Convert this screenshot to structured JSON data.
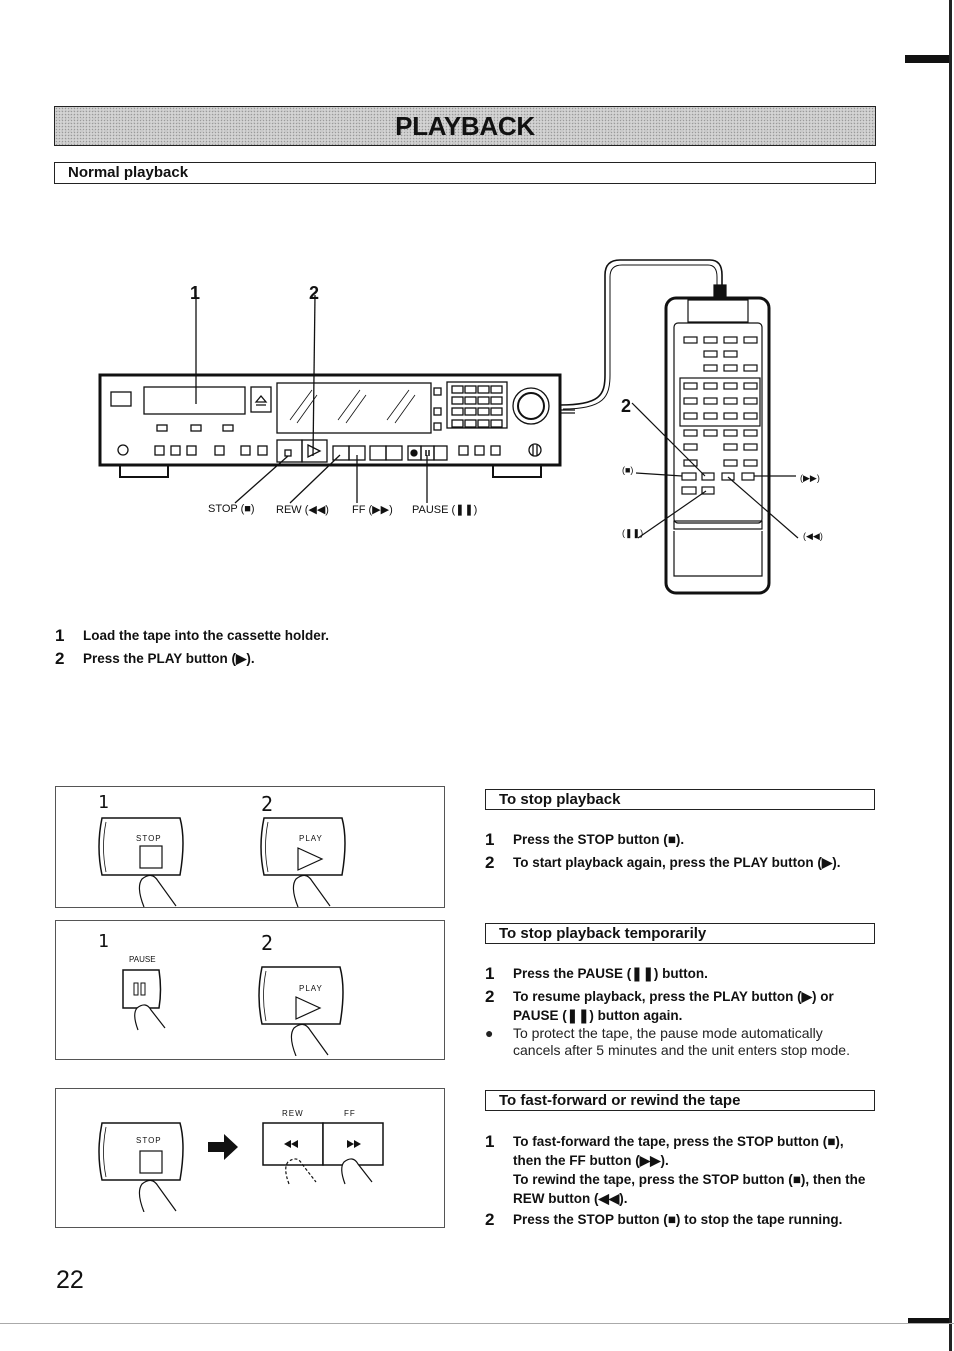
{
  "page": {
    "title": "PLAYBACK",
    "page_number": "22"
  },
  "normal_playback": {
    "heading": "Normal playback",
    "deck_callouts": {
      "step1": "1",
      "step2": "2",
      "stop": "STOP (■)",
      "rew": "REW (◀◀)",
      "ff": "FF (▶▶)",
      "pause": "PAUSE (❚❚)"
    },
    "remote_callouts": {
      "step2": "2",
      "stop": "(■)",
      "pause": "(❚❚)",
      "ff": "(▶▶)",
      "rew": "(◀◀)"
    },
    "steps": [
      {
        "num": "1",
        "text": "Load the tape into the cassette holder."
      },
      {
        "num": "2",
        "text": "Press the PLAY button (▶)."
      }
    ]
  },
  "illustrations": {
    "panel1": {
      "step1": "1",
      "step2": "2",
      "stop_label": "STOP",
      "play_label": "PLAY"
    },
    "panel2": {
      "step1": "1",
      "step2": "2",
      "pause_label": "PAUSE",
      "play_label": "PLAY"
    },
    "panel3": {
      "stop_label": "STOP",
      "rew_label": "REW",
      "ff_label": "FF"
    }
  },
  "stop_playback": {
    "heading": "To stop playback",
    "steps": [
      {
        "num": "1",
        "text": "Press the STOP button (■)."
      },
      {
        "num": "2",
        "text": "To start playback again, press the PLAY button (▶)."
      }
    ]
  },
  "stop_temporarily": {
    "heading": "To stop playback temporarily",
    "steps": [
      {
        "num": "1",
        "text": "Press the PAUSE (❚❚) button."
      },
      {
        "num": "2",
        "text": "To resume playback, press the PLAY button (▶) or PAUSE (❚❚) button again."
      }
    ],
    "note_bullet": "●",
    "note": "To protect the tape, the pause mode automatically cancels after 5 minutes and the unit enters stop mode."
  },
  "ff_rewind": {
    "heading": "To fast-forward or rewind the tape",
    "steps": [
      {
        "num": "1",
        "text": "To fast-forward the tape, press the STOP button (■), then the FF button (▶▶).",
        "text2": "To rewind the tape, press the STOP button (■), then the REW button (◀◀)."
      },
      {
        "num": "2",
        "text": "Press the STOP button (■) to stop the tape running."
      }
    ]
  }
}
